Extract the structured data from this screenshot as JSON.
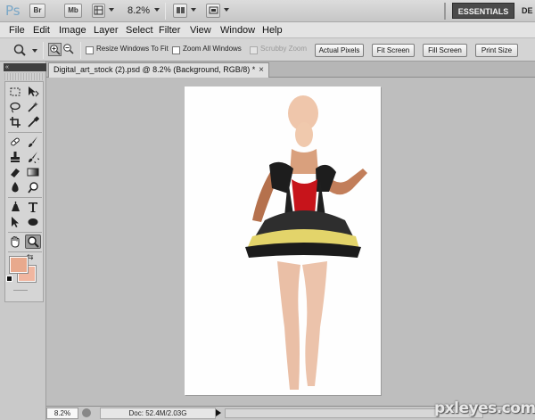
{
  "appbar": {
    "logo": "Ps",
    "bridge_label": "Br",
    "minibridge_label": "Mb",
    "zoom": "8.2%",
    "workspace": "ESSENTIALS",
    "workspace_next": "DE"
  },
  "menu": [
    "File",
    "Edit",
    "Image",
    "Layer",
    "Select",
    "Filter",
    "View",
    "Window",
    "Help"
  ],
  "options": {
    "resize_windows": "Resize Windows To Fit",
    "zoom_all": "Zoom All Windows",
    "scrubby": "Scrubby Zoom",
    "actual_pixels": "Actual Pixels",
    "fit_screen": "Fit Screen",
    "fill_screen": "Fill Screen",
    "print_size": "Print Size"
  },
  "tools_panel": {
    "collapse": "«",
    "foreground_color": "#e8a98d",
    "background_color": "#f0b6a0"
  },
  "document": {
    "tab_title": "Digital_art_stock (2).psd @ 8.2% (Background, RGB/8) *",
    "close": "×"
  },
  "status": {
    "zoom": "8.2%",
    "doc_info": "Doc: 52.4M/2.03G"
  },
  "watermark": "pxleyes.com"
}
